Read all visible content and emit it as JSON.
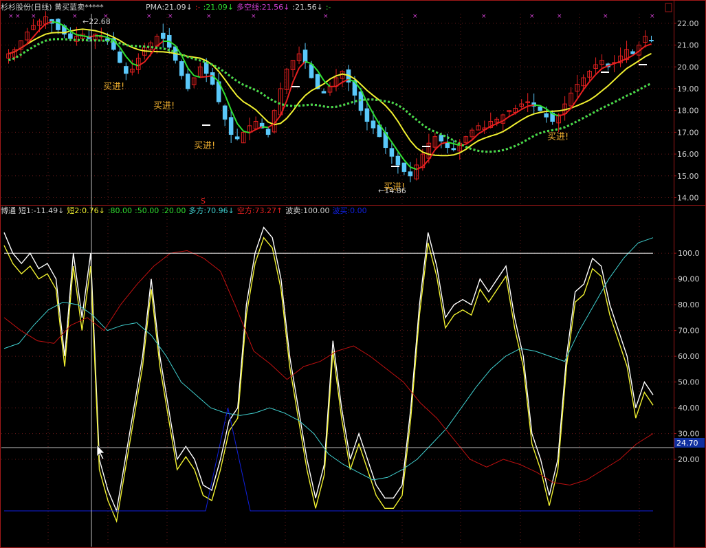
{
  "colors": {
    "bg": "#000000",
    "frame": "#a01818",
    "grid": "#6a1a1a",
    "axis_text": "#d0d0d0",
    "up": "#e82020",
    "down": "#5ac8fa",
    "yellow": "#f0f030",
    "green": "#30e030",
    "white": "#ffffff",
    "purple": "#d040d0",
    "cyan": "#40d0d0",
    "darkred": "#c01010",
    "blue": "#1020e0",
    "label_orange": "#f0b030"
  },
  "top_header": {
    "title": "杉杉股份(日线) 黄买蓝卖*****",
    "items": [
      {
        "text": "PMA:21.09",
        "arrow": "↓",
        "color": "#d0d0d0"
      },
      {
        "text": ":-",
        "arrow": "",
        "color": "#e82020"
      },
      {
        "text": ":21.09",
        "arrow": "↓",
        "color": "#30e030"
      },
      {
        "text": "多空线:21.56",
        "arrow": "↓",
        "color": "#d040d0"
      },
      {
        "text": ":21.56",
        "arrow": "↓",
        "color": "#d0d0d0"
      },
      {
        "text": ":-",
        "arrow": "",
        "color": "#30e030"
      }
    ]
  },
  "bottom_header": {
    "items": [
      {
        "text": "博通",
        "color": "#d0d0d0"
      },
      {
        "text": "短1:-11.49",
        "color": "#d0d0d0",
        "arrow": "↓"
      },
      {
        "text": "短2:0.76",
        "color": "#f0f030",
        "arrow": "↓"
      },
      {
        "text": ":80.00",
        "color": "#30e030"
      },
      {
        "text": ":50.00",
        "color": "#30e030"
      },
      {
        "text": ":20.00",
        "color": "#30e030"
      },
      {
        "text": "多方:70.96",
        "color": "#40d0d0",
        "arrow": "↓"
      },
      {
        "text": "空方:73.27",
        "color": "#e82020",
        "arrow": "↑"
      },
      {
        "text": "波卖:100.00",
        "color": "#d0d0d0"
      },
      {
        "text": "波买:0.00",
        "color": "#1020e0"
      }
    ]
  },
  "annotations": {
    "high_label": "22.68",
    "low_label": "14.86",
    "buy_label": "买进!",
    "cursor_value": "24.70",
    "red_marker": "S"
  },
  "chart_data": [
    {
      "type": "candlestick",
      "title": "杉杉股份(日线)",
      "ylim": [
        13.7,
        22.5
      ],
      "y_ticks": [
        "22.00",
        "21.00",
        "20.00",
        "19.00",
        "18.00",
        "17.00",
        "16.00",
        "15.00",
        "14.00"
      ],
      "buy_signals": [
        "买进!",
        "买进!",
        "买进!",
        "买进!",
        "买进!"
      ],
      "close_series": [
        20.6,
        20.8,
        21.2,
        21.6,
        21.9,
        22.1,
        22.3,
        22.0,
        21.7,
        21.5,
        21.3,
        21.4,
        21.5,
        21.3,
        21.5,
        21.4,
        21.2,
        20.8,
        20.2,
        19.7,
        19.9,
        20.4,
        20.9,
        21.1,
        21.4,
        21.3,
        20.9,
        20.3,
        19.6,
        19.0,
        19.5,
        20.0,
        19.7,
        19.2,
        18.4,
        17.6,
        16.9,
        16.7,
        17.0,
        17.3,
        17.5,
        17.2,
        16.9,
        18.0,
        19.0,
        19.9,
        20.3,
        20.6,
        20.2,
        19.5,
        19.0,
        18.8,
        19.1,
        19.5,
        19.8,
        19.3,
        18.7,
        18.0,
        17.5,
        17.2,
        16.8,
        16.3,
        15.9,
        15.5,
        15.2,
        15.0,
        15.5,
        16.0,
        16.5,
        16.8,
        16.6,
        16.3,
        16.2,
        16.5,
        16.8,
        17.1,
        17.3,
        17.2,
        17.5,
        17.6,
        17.8,
        18.0,
        18.1,
        18.3,
        18.4,
        18.2,
        18.0,
        17.7,
        17.5,
        17.8,
        18.3,
        18.8,
        19.2,
        19.5,
        19.8,
        20.1,
        20.3,
        20.0,
        20.2,
        20.5,
        20.8,
        20.6,
        21.0,
        21.4,
        21.2
      ]
    },
    {
      "type": "line",
      "title": "博通",
      "ylim": [
        0,
        115
      ],
      "y_ticks": [
        "100.0",
        "90.00",
        "80.00",
        "70.00",
        "60.00",
        "50.00",
        "40.00",
        "30.00",
        "20.00"
      ],
      "series": [
        {
          "name": "短1",
          "values": [
            108,
            100,
            96,
            100,
            94,
            96,
            90,
            60,
            100,
            75,
            100,
            20,
            8,
            0,
            20,
            40,
            60,
            90,
            60,
            40,
            20,
            25,
            20,
            10,
            8,
            20,
            35,
            40,
            80,
            100,
            110,
            106,
            90,
            60,
            40,
            20,
            5,
            18,
            66,
            40,
            20,
            30,
            20,
            10,
            5,
            5,
            10,
            40,
            80,
            108,
            95,
            75,
            80,
            82,
            80,
            90,
            85,
            90,
            95,
            75,
            60,
            30,
            20,
            6,
            20,
            60,
            85,
            88,
            98,
            95,
            80,
            70,
            60,
            40,
            50,
            45
          ]
        },
        {
          "name": "短2",
          "values": [
            103,
            96,
            92,
            95,
            90,
            92,
            86,
            56,
            95,
            70,
            95,
            16,
            4,
            -4,
            16,
            36,
            56,
            86,
            56,
            36,
            16,
            21,
            16,
            6,
            4,
            16,
            31,
            36,
            76,
            96,
            106,
            102,
            86,
            56,
            36,
            16,
            1,
            14,
            62,
            36,
            16,
            26,
            16,
            6,
            1,
            1,
            6,
            36,
            76,
            104,
            91,
            71,
            76,
            78,
            76,
            86,
            81,
            86,
            91,
            71,
            56,
            26,
            16,
            2,
            16,
            56,
            81,
            84,
            94,
            91,
            76,
            66,
            56,
            36,
            46,
            41
          ]
        },
        {
          "name": "多方",
          "values": [
            63,
            65,
            72,
            78,
            81,
            80,
            76,
            70,
            72,
            73,
            68,
            60,
            50,
            45,
            40,
            38,
            37,
            38,
            40,
            38,
            35,
            30,
            22,
            18,
            15,
            12,
            13,
            16,
            20,
            26,
            32,
            40,
            48,
            55,
            60,
            63,
            62,
            60,
            58,
            70,
            80,
            90,
            98,
            104,
            106
          ]
        },
        {
          "name": "空方",
          "values": [
            75,
            70,
            66,
            65,
            72,
            75,
            70,
            80,
            88,
            95,
            100,
            101,
            98,
            93,
            78,
            62,
            57,
            51,
            56,
            58,
            62,
            64,
            60,
            55,
            50,
            42,
            36,
            28,
            20,
            17,
            20,
            18,
            15,
            11,
            10,
            12,
            16,
            20,
            26,
            30
          ]
        },
        {
          "name": "波卖",
          "values": [
            100,
            100,
            100,
            100,
            100,
            100,
            100,
            100,
            100,
            100,
            100,
            100,
            100
          ]
        },
        {
          "name": "波买",
          "values": [
            0,
            0,
            0,
            0,
            0,
            0,
            0,
            0,
            0,
            0,
            40,
            0,
            0,
            0,
            0,
            0,
            0,
            0,
            0,
            0,
            0,
            0,
            0,
            0,
            0,
            0,
            0,
            0,
            0,
            0
          ]
        }
      ]
    }
  ]
}
